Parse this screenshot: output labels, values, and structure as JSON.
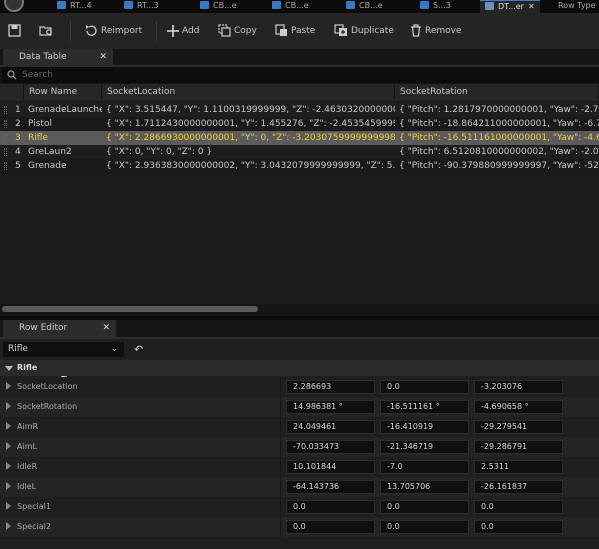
{
  "tabs": [
    {
      "label": "RT...4"
    },
    {
      "label": "RT...3"
    },
    {
      "label": "CB...e"
    },
    {
      "label": "CB...e"
    },
    {
      "label": "CB...e"
    },
    {
      "label": "S...3"
    },
    {
      "label": "DT...er"
    },
    {
      "label": "Row Type"
    }
  ],
  "toolbar": {
    "reimport": "Reimport",
    "add": "Add",
    "copy": "Copy",
    "paste": "Paste",
    "duplicate": "Duplicate",
    "remove": "Remove"
  },
  "data_table": {
    "tab_label": "Data Table",
    "search_placeholder": "Search",
    "columns": [
      "Row Name",
      "SocketLocation",
      "SocketRotation"
    ],
    "rows": [
      {
        "index": "1",
        "name": "GrenadeLaunche",
        "location": "{ \"X\": 3.515447, \"Y\": 1.1100319999999, \"Z\": -2.4630320000000001 }",
        "rotation": "{ \"Pitch\": 1.2817970000000001, \"Yaw\": -2.789816"
      },
      {
        "index": "2",
        "name": "Pistol",
        "location": "{ \"X\": 1.7112430000000001, \"Y\": 1.455276, \"Z\": -2.4535459999999998 }",
        "rotation": "{ \"Pitch\": -18.864211000000001, \"Yaw\": -6.718322"
      },
      {
        "index": "3",
        "name": "Rifle",
        "location": "{ \"X\": 2.2866930000000001, \"Y\": 0, \"Z\": -3.2030759999999998 }",
        "rotation": "{ \"Pitch\": -16.511161000000001, \"Yaw\": -4.690658"
      },
      {
        "index": "4",
        "name": "GreLaun2",
        "location": "{ \"X\": 0, \"Y\": 0, \"Z\": 0 }",
        "rotation": "{ \"Pitch\": 6.5120810000000002, \"Yaw\": -2.059823"
      },
      {
        "index": "5",
        "name": "Grenade",
        "location": "{ \"X\": 2.9363830000000002, \"Y\": 3.0432079999999999, \"Z\": 5.023218 }",
        "rotation": "{ \"Pitch\": -90.379880999999997, \"Yaw\": -52.404070"
      }
    ]
  },
  "row_editor": {
    "tab_label": "Row Editor",
    "selected_row": "Rifle",
    "category": "Rifle",
    "properties": [
      {
        "name": "SocketLocation",
        "v1": "2.286693",
        "v2": "0.0",
        "v3": "-3.203076"
      },
      {
        "name": "SocketRotation",
        "v1": "14.986381 °",
        "v2": "-16.511161 °",
        "v3": "-4.690658 °"
      },
      {
        "name": "AimR",
        "v1": "24.049461",
        "v2": "-16.410919",
        "v3": "-29.279541"
      },
      {
        "name": "AimL",
        "v1": "-70.033473",
        "v2": "-21.346719",
        "v3": "-29.286791"
      },
      {
        "name": "IdleR",
        "v1": "10.101844",
        "v2": "-7.0",
        "v3": "2.5311"
      },
      {
        "name": "IdleL",
        "v1": "-64.143736",
        "v2": "13.705706",
        "v3": "-26.161837"
      },
      {
        "name": "Special1",
        "v1": "0.0",
        "v2": "0.0",
        "v3": "0.0"
      },
      {
        "name": "Special2",
        "v1": "0.0",
        "v2": "0.0",
        "v3": "0.0"
      }
    ]
  }
}
